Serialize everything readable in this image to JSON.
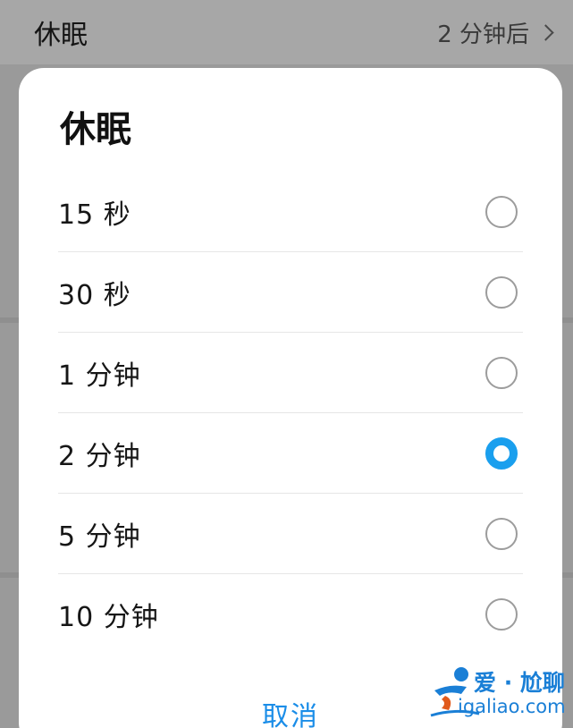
{
  "background": {
    "title": "休眠",
    "value": "2 分钟后"
  },
  "dialog": {
    "title": "休眠",
    "options": [
      {
        "label": "15 秒",
        "selected": false
      },
      {
        "label": "30 秒",
        "selected": false
      },
      {
        "label": "1 分钟",
        "selected": false
      },
      {
        "label": "2 分钟",
        "selected": true
      },
      {
        "label": "5 分钟",
        "selected": false
      },
      {
        "label": "10 分钟",
        "selected": false
      }
    ],
    "cancel_label": "取消"
  },
  "watermark": {
    "line1": "爱 · 尬聊",
    "line2": "igaliao.com"
  },
  "colors": {
    "accent": "#1a9fee",
    "cancel": "#1a8de8"
  }
}
